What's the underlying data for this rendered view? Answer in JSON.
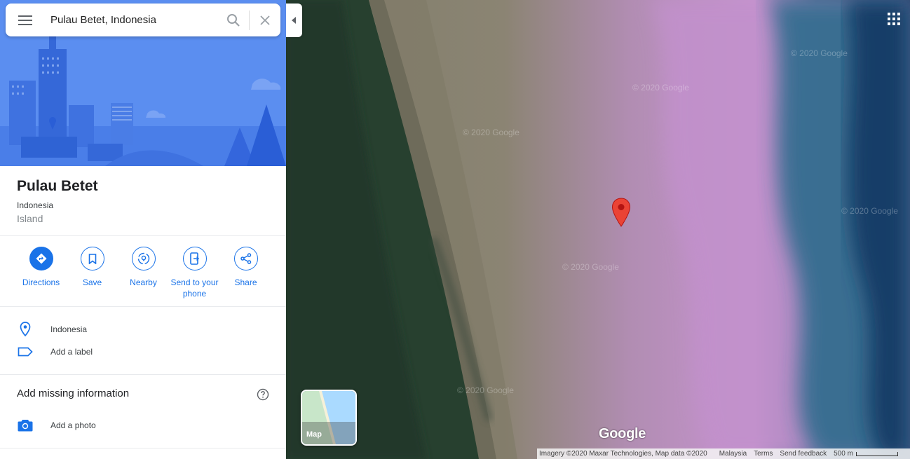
{
  "search": {
    "value": "Pulau Betet, Indonesia",
    "icon_menu": "menu-icon",
    "icon_search": "search-icon",
    "icon_close": "close-icon"
  },
  "place": {
    "title": "Pulau Betet",
    "region": "Indonesia",
    "category": "Island"
  },
  "actions": [
    {
      "label": "Directions",
      "icon": "directions-icon"
    },
    {
      "label": "Save",
      "icon": "bookmark-icon"
    },
    {
      "label": "Nearby",
      "icon": "nearby-icon"
    },
    {
      "label": "Send to your phone",
      "icon": "send-to-phone-icon"
    },
    {
      "label": "Share",
      "icon": "share-icon"
    }
  ],
  "info": {
    "address": "Indonesia",
    "label_prompt": "Add a label"
  },
  "missing": {
    "title": "Add missing information",
    "photo": "Add a photo"
  },
  "map": {
    "watermark": "© 2020 Google",
    "minimap_label": "Map",
    "logo": "Google",
    "attribution": "Imagery ©2020 Maxar Technologies, Map data ©2020",
    "country": "Malaysia",
    "terms": "Terms",
    "feedback": "Send feedback",
    "scale": "500 m"
  },
  "colors": {
    "accent": "#1a73e8",
    "pin": "#ea4335"
  }
}
